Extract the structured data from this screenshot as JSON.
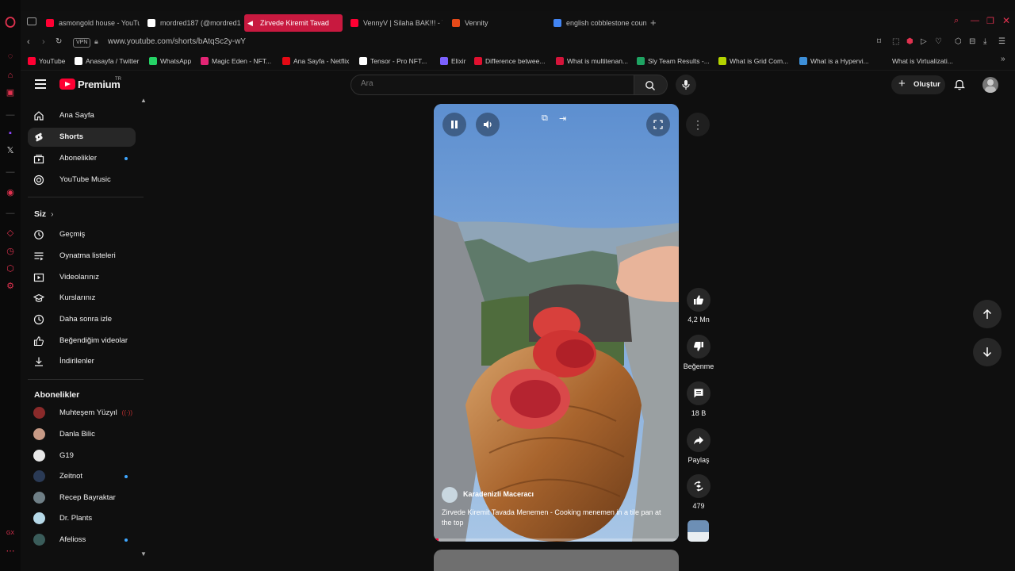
{
  "browser": {
    "tabs": [
      {
        "label": "asmongold house - YouTu",
        "active": false,
        "color": "#ff0033"
      },
      {
        "label": "mordred187 (@mordred1",
        "active": false,
        "color": "#ffffff"
      },
      {
        "label": "Zirvede Kiremit Tavad",
        "active": true,
        "color": "#ff0033"
      },
      {
        "label": "VennyV | Silaha BAK!!! - Y",
        "active": false,
        "color": "#ff0033"
      },
      {
        "label": "Vennity",
        "active": false,
        "color": "#e64a19"
      },
      {
        "label": "english cobblestone coun",
        "active": false,
        "color": "#4285f4"
      }
    ],
    "url": "www.youtube.com/shorts/bAtqSc2y-wY",
    "vpn_label": "VPN",
    "bookmarks": [
      {
        "label": "YouTube",
        "color": "#ff0033"
      },
      {
        "label": "Anasayfa / Twitter",
        "color": "#ffffff"
      },
      {
        "label": "WhatsApp",
        "color": "#25d366"
      },
      {
        "label": "Magic Eden - NFT...",
        "color": "#e42575"
      },
      {
        "label": "Ana Sayfa - Netflix",
        "color": "#e50914"
      },
      {
        "label": "Tensor - Pro NFT...",
        "color": "#ffffff"
      },
      {
        "label": "Elixir",
        "color": "#7b61ff"
      },
      {
        "label": "Difference betwee...",
        "color": "#e0102f"
      },
      {
        "label": "What is multitenan...",
        "color": "#d4143a"
      },
      {
        "label": "Sly Team Results -...",
        "color": "#1ea362"
      },
      {
        "label": "What is Grid Com...",
        "color": "#b4d400"
      },
      {
        "label": "What is a Hypervi...",
        "color": "#3d8fd8"
      },
      {
        "label": "What is Virtualizati...",
        "color": "#101010"
      }
    ]
  },
  "youtube": {
    "logo_text": "Premium",
    "logo_badge": "TR",
    "search_placeholder": "Ara",
    "create_label": "Oluştur"
  },
  "sidebar": {
    "main": [
      {
        "label": "Ana Sayfa",
        "icon": "home-icon",
        "active": false
      },
      {
        "label": "Shorts",
        "icon": "shorts-icon",
        "active": true
      },
      {
        "label": "Abonelikler",
        "icon": "subscriptions-icon",
        "active": false,
        "dot": true
      },
      {
        "label": "YouTube Music",
        "icon": "music-icon",
        "active": false
      }
    ],
    "you_heading": "Siz",
    "you": [
      {
        "label": "Geçmiş",
        "icon": "history-icon"
      },
      {
        "label": "Oynatma listeleri",
        "icon": "playlists-icon"
      },
      {
        "label": "Videolarınız",
        "icon": "your-videos-icon"
      },
      {
        "label": "Kurslarınız",
        "icon": "courses-icon"
      },
      {
        "label": "Daha sonra izle",
        "icon": "watch-later-icon"
      },
      {
        "label": "Beğendiğim videolar",
        "icon": "liked-icon"
      },
      {
        "label": "İndirilenler",
        "icon": "download-icon"
      }
    ],
    "subs_heading": "Abonelikler",
    "subscriptions": [
      {
        "label": "Muhteşem Yüzyıl",
        "color": "#8a2a2a",
        "live": true,
        "dot": false
      },
      {
        "label": "Danla Bilic",
        "color": "#c79a86",
        "live": false,
        "dot": false
      },
      {
        "label": "G19",
        "color": "#e8e8e8",
        "live": false,
        "dot": false
      },
      {
        "label": "Zeitnot",
        "color": "#2a3a55",
        "live": false,
        "dot": true
      },
      {
        "label": "Recep Bayraktar",
        "color": "#6f7f86",
        "live": false,
        "dot": false
      },
      {
        "label": "Dr. Plants",
        "color": "#b6d9e8",
        "live": false,
        "dot": false
      },
      {
        "label": "Afelioss",
        "color": "#3a5c5a",
        "live": false,
        "dot": true
      }
    ]
  },
  "short": {
    "channel": "Karadenizli Maceracı",
    "title": "Zirvede Kiremit Tavada Menemen - Cooking menemen in a tile pan at the top",
    "likes": "4,2 Mn",
    "dislike_label": "Beğenme",
    "comments": "18 B",
    "share_label": "Paylaş",
    "remix_count": "479"
  }
}
